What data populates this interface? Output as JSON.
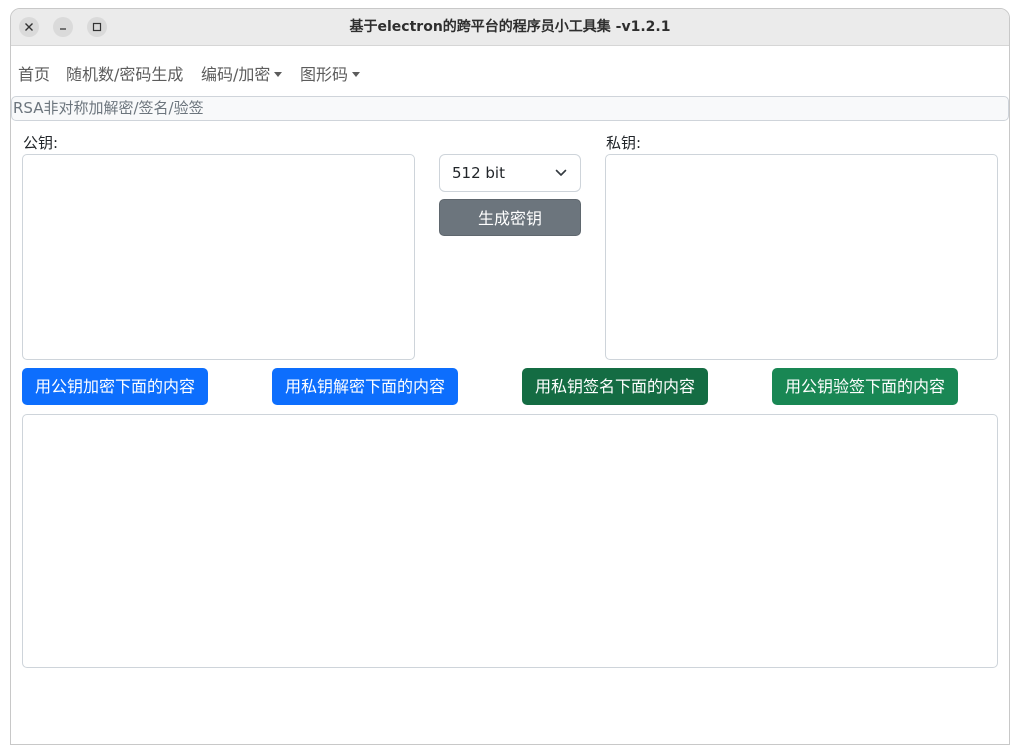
{
  "window": {
    "title": "基于electron的跨平台的程序员小工具集 -v1.2.1"
  },
  "nav": {
    "items": [
      {
        "label": "首页",
        "dropdown": false
      },
      {
        "label": "随机数/密码生成",
        "dropdown": false
      },
      {
        "label": "编码/加密",
        "dropdown": true
      },
      {
        "label": "图形码",
        "dropdown": true
      }
    ]
  },
  "section": {
    "title": "RSA非对称加解密/签名/验签"
  },
  "rsa": {
    "public_key_label": "公钥:",
    "private_key_label": "私钥:",
    "public_key_value": "",
    "private_key_value": "",
    "key_size": "512 bit",
    "generate_label": "生成密钥",
    "content_value": ""
  },
  "actions": {
    "encrypt_label": "用公钥加密下面的内容",
    "decrypt_label": "用私钥解密下面的内容",
    "sign_label": "用私钥签名下面的内容",
    "verify_label": "用公钥验签下面的内容"
  },
  "colors": {
    "primary": "#0d6efd",
    "secondary": "#6c757d",
    "success_dark": "#146c43",
    "success": "#198754"
  },
  "icons": {
    "close": "close-icon",
    "minimize": "minimize-icon",
    "maximize": "maximize-icon",
    "select_chevron": "chevron-down-icon"
  }
}
